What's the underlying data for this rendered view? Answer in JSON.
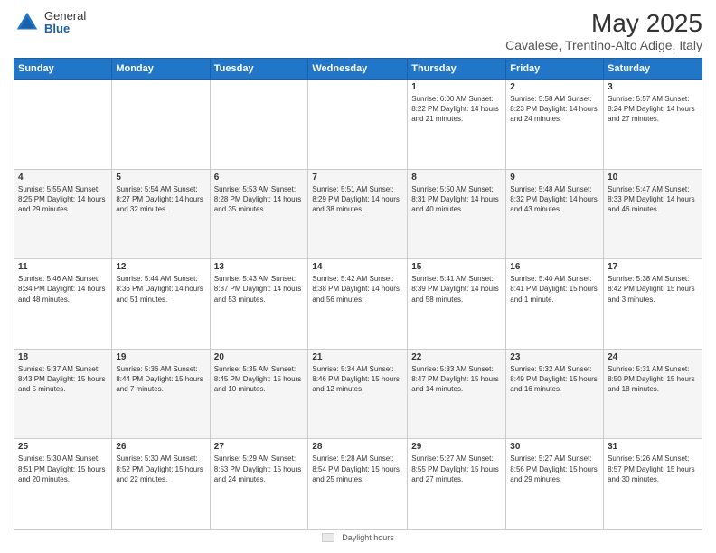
{
  "header": {
    "logo_general": "General",
    "logo_blue": "Blue",
    "month_title": "May 2025",
    "location": "Cavalese, Trentino-Alto Adige, Italy"
  },
  "weekdays": [
    "Sunday",
    "Monday",
    "Tuesday",
    "Wednesday",
    "Thursday",
    "Friday",
    "Saturday"
  ],
  "footer": {
    "label": "Daylight hours"
  },
  "weeks": [
    [
      {
        "day": "",
        "info": ""
      },
      {
        "day": "",
        "info": ""
      },
      {
        "day": "",
        "info": ""
      },
      {
        "day": "",
        "info": ""
      },
      {
        "day": "1",
        "info": "Sunrise: 6:00 AM\nSunset: 8:22 PM\nDaylight: 14 hours\nand 21 minutes."
      },
      {
        "day": "2",
        "info": "Sunrise: 5:58 AM\nSunset: 8:23 PM\nDaylight: 14 hours\nand 24 minutes."
      },
      {
        "day": "3",
        "info": "Sunrise: 5:57 AM\nSunset: 8:24 PM\nDaylight: 14 hours\nand 27 minutes."
      }
    ],
    [
      {
        "day": "4",
        "info": "Sunrise: 5:55 AM\nSunset: 8:25 PM\nDaylight: 14 hours\nand 29 minutes."
      },
      {
        "day": "5",
        "info": "Sunrise: 5:54 AM\nSunset: 8:27 PM\nDaylight: 14 hours\nand 32 minutes."
      },
      {
        "day": "6",
        "info": "Sunrise: 5:53 AM\nSunset: 8:28 PM\nDaylight: 14 hours\nand 35 minutes."
      },
      {
        "day": "7",
        "info": "Sunrise: 5:51 AM\nSunset: 8:29 PM\nDaylight: 14 hours\nand 38 minutes."
      },
      {
        "day": "8",
        "info": "Sunrise: 5:50 AM\nSunset: 8:31 PM\nDaylight: 14 hours\nand 40 minutes."
      },
      {
        "day": "9",
        "info": "Sunrise: 5:48 AM\nSunset: 8:32 PM\nDaylight: 14 hours\nand 43 minutes."
      },
      {
        "day": "10",
        "info": "Sunrise: 5:47 AM\nSunset: 8:33 PM\nDaylight: 14 hours\nand 46 minutes."
      }
    ],
    [
      {
        "day": "11",
        "info": "Sunrise: 5:46 AM\nSunset: 8:34 PM\nDaylight: 14 hours\nand 48 minutes."
      },
      {
        "day": "12",
        "info": "Sunrise: 5:44 AM\nSunset: 8:36 PM\nDaylight: 14 hours\nand 51 minutes."
      },
      {
        "day": "13",
        "info": "Sunrise: 5:43 AM\nSunset: 8:37 PM\nDaylight: 14 hours\nand 53 minutes."
      },
      {
        "day": "14",
        "info": "Sunrise: 5:42 AM\nSunset: 8:38 PM\nDaylight: 14 hours\nand 56 minutes."
      },
      {
        "day": "15",
        "info": "Sunrise: 5:41 AM\nSunset: 8:39 PM\nDaylight: 14 hours\nand 58 minutes."
      },
      {
        "day": "16",
        "info": "Sunrise: 5:40 AM\nSunset: 8:41 PM\nDaylight: 15 hours\nand 1 minute."
      },
      {
        "day": "17",
        "info": "Sunrise: 5:38 AM\nSunset: 8:42 PM\nDaylight: 15 hours\nand 3 minutes."
      }
    ],
    [
      {
        "day": "18",
        "info": "Sunrise: 5:37 AM\nSunset: 8:43 PM\nDaylight: 15 hours\nand 5 minutes."
      },
      {
        "day": "19",
        "info": "Sunrise: 5:36 AM\nSunset: 8:44 PM\nDaylight: 15 hours\nand 7 minutes."
      },
      {
        "day": "20",
        "info": "Sunrise: 5:35 AM\nSunset: 8:45 PM\nDaylight: 15 hours\nand 10 minutes."
      },
      {
        "day": "21",
        "info": "Sunrise: 5:34 AM\nSunset: 8:46 PM\nDaylight: 15 hours\nand 12 minutes."
      },
      {
        "day": "22",
        "info": "Sunrise: 5:33 AM\nSunset: 8:47 PM\nDaylight: 15 hours\nand 14 minutes."
      },
      {
        "day": "23",
        "info": "Sunrise: 5:32 AM\nSunset: 8:49 PM\nDaylight: 15 hours\nand 16 minutes."
      },
      {
        "day": "24",
        "info": "Sunrise: 5:31 AM\nSunset: 8:50 PM\nDaylight: 15 hours\nand 18 minutes."
      }
    ],
    [
      {
        "day": "25",
        "info": "Sunrise: 5:30 AM\nSunset: 8:51 PM\nDaylight: 15 hours\nand 20 minutes."
      },
      {
        "day": "26",
        "info": "Sunrise: 5:30 AM\nSunset: 8:52 PM\nDaylight: 15 hours\nand 22 minutes."
      },
      {
        "day": "27",
        "info": "Sunrise: 5:29 AM\nSunset: 8:53 PM\nDaylight: 15 hours\nand 24 minutes."
      },
      {
        "day": "28",
        "info": "Sunrise: 5:28 AM\nSunset: 8:54 PM\nDaylight: 15 hours\nand 25 minutes."
      },
      {
        "day": "29",
        "info": "Sunrise: 5:27 AM\nSunset: 8:55 PM\nDaylight: 15 hours\nand 27 minutes."
      },
      {
        "day": "30",
        "info": "Sunrise: 5:27 AM\nSunset: 8:56 PM\nDaylight: 15 hours\nand 29 minutes."
      },
      {
        "day": "31",
        "info": "Sunrise: 5:26 AM\nSunset: 8:57 PM\nDaylight: 15 hours\nand 30 minutes."
      }
    ]
  ]
}
